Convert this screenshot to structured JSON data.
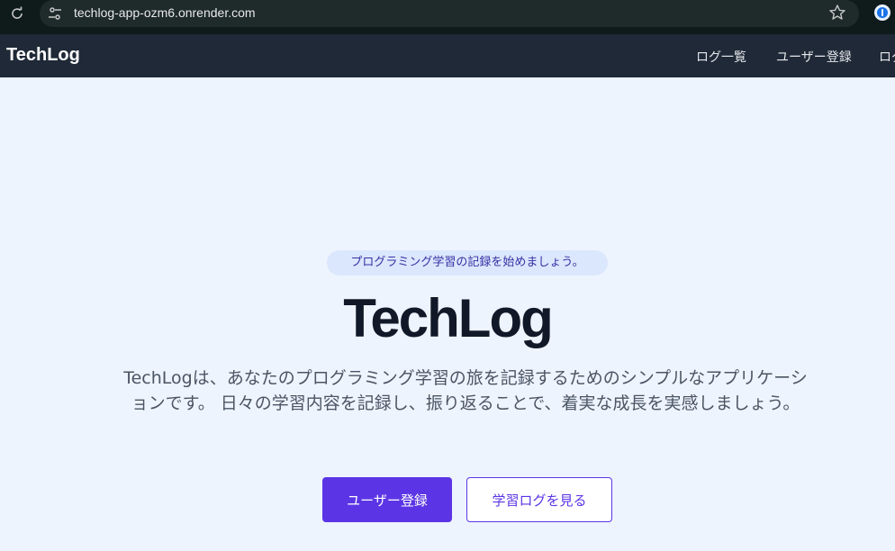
{
  "browser": {
    "url": "techlog-app-ozm6.onrender.com",
    "icons": {
      "reload": "reload-icon",
      "site_info": "site-info-icon",
      "bookmark": "star-icon",
      "extension": "password-manager-icon"
    }
  },
  "navbar": {
    "brand": "TechLog",
    "links": [
      {
        "label": "ログ一覧"
      },
      {
        "label": "ユーザー登録"
      },
      {
        "label": "ログ"
      }
    ]
  },
  "hero": {
    "tagline": "プログラミング学習の記録を始めましょう。",
    "title": "TechLog",
    "description": "TechLogは、あなたのプログラミング学習の旅を記録するためのシンプルなアプリケーションです。 日々の学習内容を記録し、振り返ることで、着実な成長を実感しましょう。",
    "primary_button": "ユーザー登録",
    "secondary_button": "学習ログを見る"
  },
  "colors": {
    "navbar_bg": "#1f2937",
    "page_bg": "#eef4fe",
    "accent": "#5b35e5",
    "tagline_bg": "#dbe7fd"
  }
}
